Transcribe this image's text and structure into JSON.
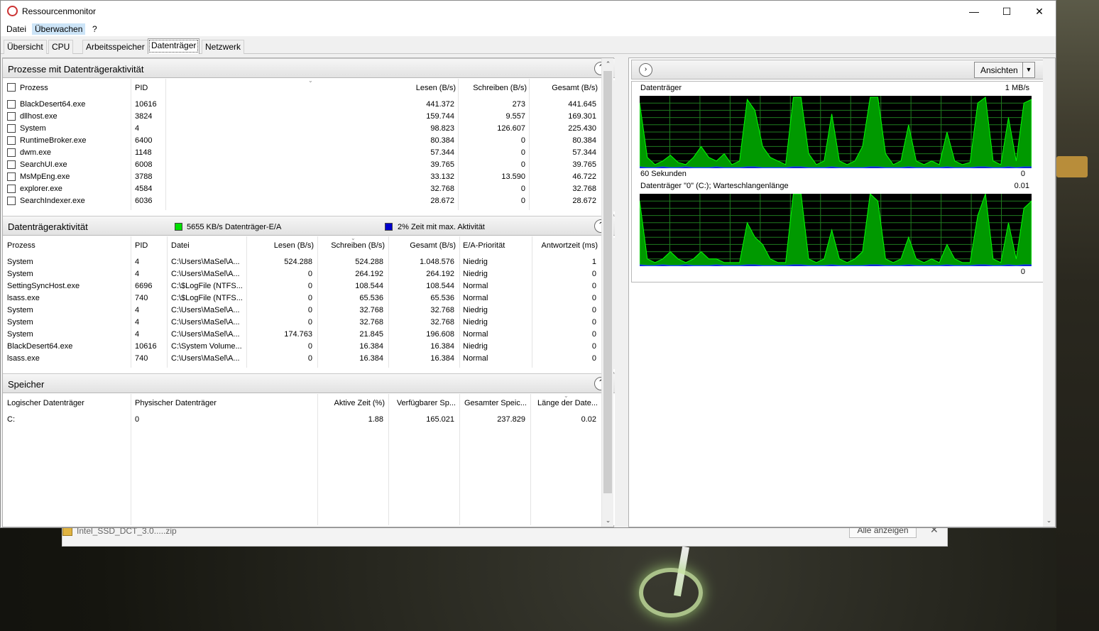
{
  "window": {
    "title": "Ressourcenmonitor",
    "menu": [
      "Datei",
      "Überwachen",
      "?"
    ],
    "tabs": [
      "Übersicht",
      "CPU",
      "Arbeitsspeicher",
      "Datenträger",
      "Netzwerk"
    ],
    "selected_tab": "Datenträger"
  },
  "processes": {
    "title": "Prozesse mit Datenträgeraktivität",
    "headers": [
      "Prozess",
      "PID",
      "Lesen (B/s)",
      "Schreiben (B/s)",
      "Gesamt (B/s)"
    ],
    "rows": [
      [
        "BlackDesert64.exe",
        "10616",
        "441.372",
        "273",
        "441.645"
      ],
      [
        "dllhost.exe",
        "3824",
        "159.744",
        "9.557",
        "169.301"
      ],
      [
        "System",
        "4",
        "98.823",
        "126.607",
        "225.430"
      ],
      [
        "RuntimeBroker.exe",
        "6400",
        "80.384",
        "0",
        "80.384"
      ],
      [
        "dwm.exe",
        "1148",
        "57.344",
        "0",
        "57.344"
      ],
      [
        "SearchUI.exe",
        "6008",
        "39.765",
        "0",
        "39.765"
      ],
      [
        "MsMpEng.exe",
        "3788",
        "33.132",
        "13.590",
        "46.722"
      ],
      [
        "explorer.exe",
        "4584",
        "32.768",
        "0",
        "32.768"
      ],
      [
        "SearchIndexer.exe",
        "6036",
        "28.672",
        "0",
        "28.672"
      ]
    ]
  },
  "disk_activity": {
    "title": "Datenträgeraktivität",
    "legend_green": "5655 KB/s Datenträger-E/A",
    "legend_blue": "2% Zeit mit max. Aktivität",
    "green_color": "#00e000",
    "blue_color": "#0000cc",
    "headers": [
      "Prozess",
      "PID",
      "Datei",
      "Lesen (B/s)",
      "Schreiben (B/s)",
      "Gesamt (B/s)",
      "E/A-Priorität",
      "Antwortzeit (ms)"
    ],
    "rows": [
      [
        "System",
        "4",
        "C:\\Users\\MaSel\\A...",
        "524.288",
        "524.288",
        "1.048.576",
        "Niedrig",
        "1"
      ],
      [
        "System",
        "4",
        "C:\\Users\\MaSel\\A...",
        "0",
        "264.192",
        "264.192",
        "Niedrig",
        "0"
      ],
      [
        "SettingSyncHost.exe",
        "6696",
        "C:\\$LogFile (NTFS...",
        "0",
        "108.544",
        "108.544",
        "Normal",
        "0"
      ],
      [
        "lsass.exe",
        "740",
        "C:\\$LogFile (NTFS...",
        "0",
        "65.536",
        "65.536",
        "Normal",
        "0"
      ],
      [
        "System",
        "4",
        "C:\\Users\\MaSel\\A...",
        "0",
        "32.768",
        "32.768",
        "Niedrig",
        "0"
      ],
      [
        "System",
        "4",
        "C:\\Users\\MaSel\\A...",
        "0",
        "32.768",
        "32.768",
        "Niedrig",
        "0"
      ],
      [
        "System",
        "4",
        "C:\\Users\\MaSel\\A...",
        "174.763",
        "21.845",
        "196.608",
        "Normal",
        "0"
      ],
      [
        "BlackDesert64.exe",
        "10616",
        "C:\\System Volume...",
        "0",
        "16.384",
        "16.384",
        "Niedrig",
        "0"
      ],
      [
        "lsass.exe",
        "740",
        "C:\\Users\\MaSel\\A...",
        "0",
        "16.384",
        "16.384",
        "Normal",
        "0"
      ]
    ]
  },
  "storage": {
    "title": "Speicher",
    "headers": [
      "Logischer Datenträger",
      "Physischer Datenträger",
      "Aktive Zeit (%)",
      "Verfügbarer Sp...",
      "Gesamter Speic...",
      "Länge der Date..."
    ],
    "rows": [
      [
        "C:",
        "0",
        "1.88",
        "165.021",
        "237.829",
        "0.02"
      ]
    ]
  },
  "right_panel": {
    "views_label": "Ansichten",
    "chart1": {
      "title": "Datenträger",
      "max_label": "1 MB/s",
      "time_label": "60 Sekunden",
      "min_label": "0"
    },
    "chart2": {
      "title": "Datenträger \"0\" (C:); Warteschlangenlänge",
      "max_label": "0.01",
      "min_label": "0"
    }
  },
  "chart_data": [
    {
      "type": "area",
      "title": "Datenträger",
      "ylabel": "1 MB/s",
      "xlabel": "60 Sekunden",
      "ylim": [
        0,
        1
      ],
      "grid": true,
      "series": [
        {
          "values": [
            0.9,
            0.15,
            0.05,
            0.1,
            0.18,
            0.08,
            0.05,
            0.15,
            0.3,
            0.15,
            0.1,
            0.2,
            0.05,
            0.1,
            0.95,
            0.8,
            0.3,
            0.15,
            0.1,
            0.05,
            0.98,
            0.98,
            0.2,
            0.05,
            0.1,
            0.75,
            0.1,
            0.05,
            0.1,
            0.3,
            0.98,
            0.98,
            0.2,
            0.05,
            0.1,
            0.6,
            0.1,
            0.05,
            0.1,
            0.05,
            0.5,
            0.1,
            0.05,
            0.08,
            0.9,
            0.98,
            0.1,
            0.05,
            0.7,
            0.1,
            0.9,
            0.95
          ]
        },
        {
          "values": [
            0.02,
            0.01,
            0.01,
            0.02,
            0.01,
            0.01,
            0.02,
            0.01,
            0.01,
            0.01,
            0.02,
            0.01,
            0.01,
            0.01,
            0.02,
            0.02,
            0.01,
            0.01,
            0.01,
            0.01,
            0.02,
            0.02,
            0.01,
            0.01,
            0.01,
            0.02,
            0.01,
            0.01,
            0.01,
            0.01,
            0.02,
            0.02,
            0.01,
            0.01,
            0.01,
            0.02,
            0.01,
            0.01,
            0.01,
            0.01,
            0.02,
            0.01,
            0.01,
            0.01,
            0.02,
            0.02,
            0.01,
            0.01,
            0.02,
            0.01,
            0.02,
            0.02
          ]
        }
      ]
    },
    {
      "type": "area",
      "title": "Datenträger \"0\" (C:); Warteschlangenlänge",
      "ylabel": "0.01",
      "ylim": [
        0,
        0.01
      ],
      "grid": true,
      "series": [
        {
          "values": [
            0.009,
            0.001,
            0.0005,
            0.001,
            0.002,
            0.001,
            0.0005,
            0.001,
            0.002,
            0.001,
            0.001,
            0.0005,
            0.0005,
            0.0005,
            0.006,
            0.004,
            0.003,
            0.001,
            0.0005,
            0.0005,
            0.01,
            0.01,
            0.001,
            0.0005,
            0.001,
            0.005,
            0.001,
            0.0005,
            0.001,
            0.002,
            0.01,
            0.009,
            0.001,
            0.0005,
            0.001,
            0.004,
            0.001,
            0.0005,
            0.001,
            0.0005,
            0.003,
            0.001,
            0.0005,
            0.0005,
            0.007,
            0.01,
            0.001,
            0.0005,
            0.006,
            0.001,
            0.008,
            0.009
          ]
        },
        {
          "values": [
            0.0002,
            0.0001,
            0.0001,
            0.0002,
            0.0001,
            0.0001,
            0.0002,
            0.0001,
            0.0001,
            0.0001,
            0.0002,
            0.0001,
            0.0001,
            0.0001,
            0.0002,
            0.0002,
            0.0001,
            0.0001,
            0.0001,
            0.0001,
            0.0002,
            0.0002,
            0.0001,
            0.0001,
            0.0001,
            0.0002,
            0.0001,
            0.0001,
            0.0001,
            0.0001,
            0.0002,
            0.0002,
            0.0001,
            0.0001,
            0.0001,
            0.0002,
            0.0001,
            0.0001,
            0.0001,
            0.0001,
            0.0002,
            0.0001,
            0.0001,
            0.0001,
            0.0002,
            0.0002,
            0.0001,
            0.0001,
            0.0002,
            0.0001,
            0.0002,
            0.0002
          ]
        }
      ]
    }
  ],
  "download_bar": {
    "file": "Intel_SSD_DCT_3.0.....zip",
    "show_all": "Alle anzeigen"
  }
}
